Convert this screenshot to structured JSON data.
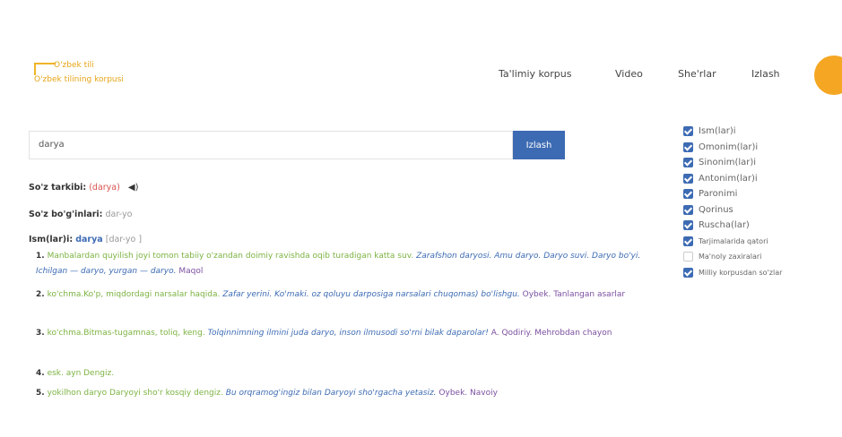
{
  "banner": {
    "text": ""
  },
  "logo": {
    "line1": "O'zbek tili",
    "line2": "O'zbek tilining korpusi"
  },
  "nav": {
    "items": [
      "Ta'limiy korpus",
      "Video",
      "She'rlar",
      "Izlash"
    ]
  },
  "search": {
    "value": "darya",
    "button_label": "Izlash"
  },
  "result": {
    "word_label": "So'z tarkibi:",
    "word_value": "(darya)",
    "syllable_label": "So'z bo'g'inlari:",
    "syllable_value": "dar-yo",
    "pos_label": "Ism(lar)i:",
    "pos_word": "darya",
    "pos_syllable": "[dar-yo ]",
    "definitions": [
      {
        "num": "1.",
        "text": "Manbalardan quyilish joyi tomon tabiiy o'zandan doimiy ravishda oqib turadigan katta suv.",
        "example": "Zarafshon daryosi. Amu daryo. Daryo suvi. Daryo bo'yi. Ichilgan — daryo, yurgan — daryo.",
        "source": "Maqol"
      },
      {
        "num": "2.",
        "text": "ko'chma.Ko'p, miqdordagi narsalar haqida.",
        "example": "Zafar yerini. Ko'maki. oz qoluyu darposiga narsalari chuqomas) bo'lishgu.",
        "source": "Oybek. Tanlangan asarlar"
      },
      {
        "num": "3.",
        "text": "ko'chma.Bitmas-tugamnas, toliq, keng.",
        "example": "Tolqinnimning ilmini juda daryo, inson ilmusodi so'rni bilak daparolar!",
        "source": "A. Qodiriy. Mehrobdan chayon"
      },
      {
        "num": "4.",
        "text": "esk. ayn Dengiz.",
        "example": "",
        "source": ""
      },
      {
        "num": "5.",
        "text": "yokilhon daryo Daryoyi sho'r kosqiy dengiz.",
        "example": "Bu orqramog'ingiz bilan Daryoyi sho'rgacha yetasiz.",
        "source": "Oybek. Navoiy"
      }
    ]
  },
  "filters": [
    {
      "label": "Ism(lar)i",
      "checked": true,
      "small": false
    },
    {
      "label": "Omonim(lar)i",
      "checked": true,
      "small": false
    },
    {
      "label": "Sinonim(lar)i",
      "checked": true,
      "small": false
    },
    {
      "label": "Antonim(lar)i",
      "checked": true,
      "small": false
    },
    {
      "label": "Paronimi",
      "checked": true,
      "small": false
    },
    {
      "label": "Qorinus",
      "checked": true,
      "small": false
    },
    {
      "label": "Ruscha(lar)",
      "checked": true,
      "small": false
    },
    {
      "label": "Tarjimalarida qatori",
      "checked": true,
      "small": true
    },
    {
      "label": "Ma'noly zaxiralari",
      "checked": false,
      "small": true
    },
    {
      "label": "Milliy korpusdan so'zlar",
      "checked": true,
      "small": true
    }
  ],
  "colors": {
    "accent": "#f5a623",
    "primary": "#3d6bb3",
    "example": "#7cb342",
    "source": "#7b4fa0",
    "highlight": "#d9534f"
  },
  "icons": {
    "speaker": "speaker-icon"
  }
}
